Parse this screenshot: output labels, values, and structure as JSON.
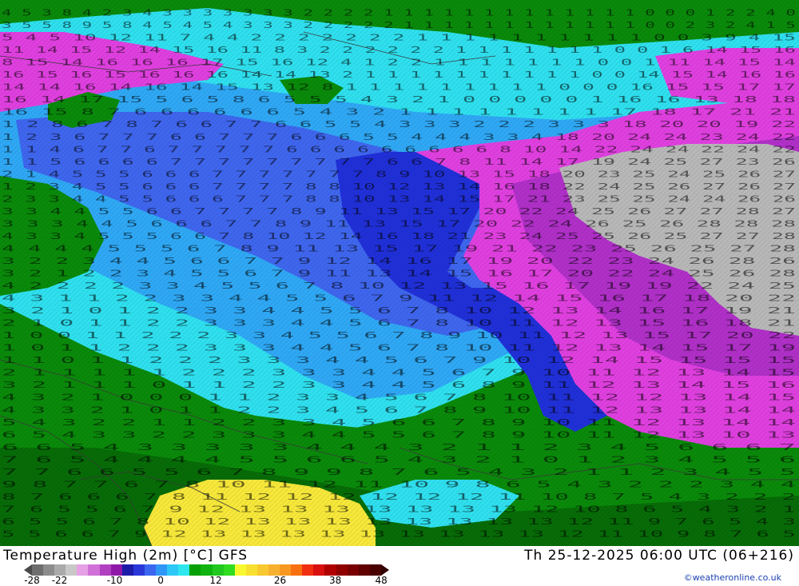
{
  "map": {
    "colors": {
      "land": "#0a8a0a",
      "land_dark": "#076c07",
      "sea_cyan": "#2fe0ef",
      "sea_light_blue": "#2fa8f5",
      "sea_blue": "#3f66ee",
      "sea_deep_blue": "#2030d8",
      "magenta": "#e040e0",
      "violet": "#b030c8",
      "gray": "#b8b8b8",
      "warm_yellow": "#f7e83a",
      "border_line": "#3a3a3a"
    },
    "value_labels": [
      {
        "row": 1,
        "text": "4 5 3 8 4 2 3 4 3 3 3 3 3 3 3 2 2 2 2 1 1 1 1 1 1 1 1 1 1 1 1 1 0 0 0 1 2 2 4 0"
      },
      {
        "row": 2,
        "text": "3 5 5 8 9 5 8 4 5 4 5 4 3 3 3 2 2 2 2 2 1 1 1 1 1 1 1 1 1 1 1 1 0 0 2 3 2 4 1 5"
      },
      {
        "row": 3,
        "text": "5 4 5 10 12 11 7 4 4 2 2 2 2 2 2 2 1 1 1 1 1 1 1 1 1 1 0 0 3 9 4 15"
      },
      {
        "row": 4,
        "text": "11 14 15 12 14 15 16 11 8 3 2 2 2 2 2 2 1 1 1 1 1 1 1 0 0 1 6 14 15 16"
      },
      {
        "row": 5,
        "text": "8 15 14 16 16 16 17 15 16 12 4 1 2 2 1 1 1 1 1 1 1 0 0 1 11 14 15 14"
      },
      {
        "row": 6,
        "text": "16 15 16 15 16 16 16 14 14 13 2 1 1 1 1 1 1 1 1 1 1 0 0 14 15 14 16 16"
      },
      {
        "row": 7,
        "text": "14 14 16 14 16 14 15 13 12 8 1 1 1 1 1 1 1 1 1 0 0 0 16 15 15 17 17"
      },
      {
        "row": 8,
        "text": "16 14 17 15 5 6 5 8 6 5 5 5 4 3 2 1 0 0 0 0 0 1 16 16 13 18 18"
      },
      {
        "row": 9,
        "text": "16 15 8 7 6 6 6 6 6 6 5 4 3 2 1 1 1 1 1 1 1 1 17 18 17 21 21"
      },
      {
        "row": 10,
        "text": "1 2 8 6 7 8 7 6 6 7 7 6 6 5 5 4 3 3 3 2 2 2 3 3 3 18 20 20 19 22"
      },
      {
        "row": 11,
        "text": "1 2 3 6 7 7 7 6 6 7 7 7 6 6 6 5 5 4 4 4 3 3 4 18 20 24 24 23 24 22"
      },
      {
        "row": 12,
        "text": "1 1 4 6 7 7 6 7 7 7 7 7 6 6 6 6 6 6 6 6 6 8 10 14 22 24 24 22 24 22"
      },
      {
        "row": 13,
        "text": "1 1 5 6 6 6 6 7 7 7 7 7 7 7 7 7 6 6 7 8 11 14 17 19 24 25 27 23 26"
      },
      {
        "row": 14,
        "text": "2 1 4 5 5 5 6 6 6 7 7 7 7 7 7 7 8 9 10 13 15 18 20 23 25 24 25 26 27"
      },
      {
        "row": 15,
        "text": "1 2 3 4 5 5 6 6 6 7 7 7 7 8 8 10 12 13 14 16 18 22 24 25 26 27 26 27"
      },
      {
        "row": 16,
        "text": "2 3 3 4 4 5 5 6 6 6 7 7 7 8 8 10 13 14 15 17 21 23 25 25 24 24 26 26"
      },
      {
        "row": 17,
        "text": "3 3 4 4 5 5 6 6 7 7 7 7 8 9 11 13 15 17 20 22 24 25 26 27 27 28 27"
      },
      {
        "row": 18,
        "text": "3 3 3 4 4 5 6 6 6 7 7 8 9 11 13 15 17 20 22 24 26 25 26 28 28 28"
      },
      {
        "row": 19,
        "text": "4 3 3 4 5 5 5 6 6 7 8 10 12 14 16 18 21 23 24 25 25 26 25 27 27 28"
      },
      {
        "row": 20,
        "text": "4 4 4 4 5 5 5 6 7 8 9 11 13 15 17 19 21 22 23 25 26 25 27 28"
      },
      {
        "row": 21,
        "text": "3 2 2 3 4 4 5 6 6 7 7 9 12 14 16 17 19 20 22 23 24 26 28 26"
      },
      {
        "row": 22,
        "text": "3 2 1 2 2 3 4 5 5 6 7 9 11 13 14 15 16 17 20 22 24 25 26 28"
      },
      {
        "row": 23,
        "text": "4 2 2 2 2 3 3 4 5 5 6 7 8 10 12 13 15 16 17 19 19 22 24 25"
      },
      {
        "row": 24,
        "text": "4 3 1 1 2 2 3 3 4 4 5 5 6 7 9 11 12 14 15 16 17 18 20 22"
      },
      {
        "row": 25,
        "text": "3 2 1 0 1 2 2 3 3 4 4 5 5 6 7 8 10 12 13 14 16 17 19 21"
      },
      {
        "row": 26,
        "text": "2 1 0 1 1 2 2 3 3 3 4 4 5 6 7 8 10 11 12 13 15 16 18 21"
      },
      {
        "row": 27,
        "text": "1 0 0 1 1 2 2 2 3 3 4 5 5 6 7 8 9 10 11 12 13 15 17 20 22"
      },
      {
        "row": 28,
        "text": "1 0 1 1 2 2 2 3 3 3 4 4 5 6 7 8 10 11 12 13 14 15 17 19"
      },
      {
        "row": 29,
        "text": "1 1 0 1 1 2 2 2 3 3 3 4 4 5 6 7 9 10 12 14 15 15 15 15"
      },
      {
        "row": 30,
        "text": "2 1 1 1 1 1 2 2 2 3 3 3 4 4 5 6 7 9 10 11 12 13 14 15"
      },
      {
        "row": 31,
        "text": "3 2 1 1 1 0 1 1 2 2 3 3 4 4 5 6 8 9 11 12 13 14 15 16"
      },
      {
        "row": 32,
        "text": "4 3 2 1 0 0 0 1 1 2 3 3 4 5 6 7 8 10 11 12 12 13 14 15"
      },
      {
        "row": 33,
        "text": "4 3 3 2 1 0 1 1 2 2 3 4 5 6 7 8 9 10 11 12 13 13 14 14"
      },
      {
        "row": 34,
        "text": "5 4 3 2 2 1 1 2 2 3 3 4 5 6 6 7 8 9 10 11 12 13 14 14"
      },
      {
        "row": 35,
        "text": "6 5 4 3 3 2 2 3 3 3 4 4 5 5 6 7 8 9 10 11 12 13 10 13"
      },
      {
        "row": 36,
        "text": "6 6 5 4 3 3 3 3 3 4 4 4 3 2 1 1 2 3 4 5 6 6 6 7"
      },
      {
        "row": 37,
        "text": "7 6 5 4 4 4 4 5 5 6 6 5 4 3 2 1 0 1 2 3 4 5 5 6"
      },
      {
        "row": 38,
        "text": "7 7 6 6 5 5 6 7 8 9 9 8 7 6 5 4 3 2 1 1 2 3 4 5 5"
      },
      {
        "row": 39,
        "text": "9 8 7 7 6 7 8 10 11 12 11 10 9 8 6 5 4 3 2 2 2 3 4 4"
      },
      {
        "row": 40,
        "text": "8 7 6 6 6 7 8 11 12 12 12 12 12 12 11 10 8 7 5 4 3 2 2 2"
      },
      {
        "row": 41,
        "text": "7 6 5 5 6 7 9 12 13 13 13 13 13 13 13 12 10 8 6 5 4 3 2 1"
      },
      {
        "row": 42,
        "text": "6 5 5 6 7 8 10 12 13 13 13 13 13 13 13 13 12 11 9 7 6 5 4 3"
      },
      {
        "row": 43,
        "text": "5 5 6 6 7 9 12 13 13 13 13 13 13 13 13 13 12 11 10 9 8 7 6 5"
      }
    ]
  },
  "footer": {
    "title": "Temperature High (2m) [°C] GFS",
    "datetime": "Th 25-12-2025 06:00 UTC (06+216)",
    "credit": "©weatheronline.co.uk",
    "colorbar": {
      "colors": [
        "#6e6e6e",
        "#8c8c8c",
        "#aaaaaa",
        "#c8c8c8",
        "#e6a0e6",
        "#d070d8",
        "#b040c0",
        "#9018a8",
        "#1c1ca8",
        "#2a38d8",
        "#3a66f0",
        "#2e96f6",
        "#2ec8f8",
        "#2ee6ee",
        "#06a006",
        "#10b410",
        "#20c820",
        "#30dc20",
        "#f8f830",
        "#f8e030",
        "#f8c830",
        "#f8b030",
        "#f89820",
        "#f87010",
        "#f03010",
        "#d81010",
        "#b00000",
        "#900000",
        "#780000",
        "#600000",
        "#480000"
      ],
      "ticks": [
        {
          "label": "-28",
          "value": -28
        },
        {
          "label": "-22",
          "value": -22
        },
        {
          "label": "-10",
          "value": -10
        },
        {
          "label": "0",
          "value": 0
        },
        {
          "label": "12",
          "value": 12
        },
        {
          "label": "26",
          "value": 26
        },
        {
          "label": "38",
          "value": 38
        },
        {
          "label": "48",
          "value": 48
        }
      ]
    }
  }
}
